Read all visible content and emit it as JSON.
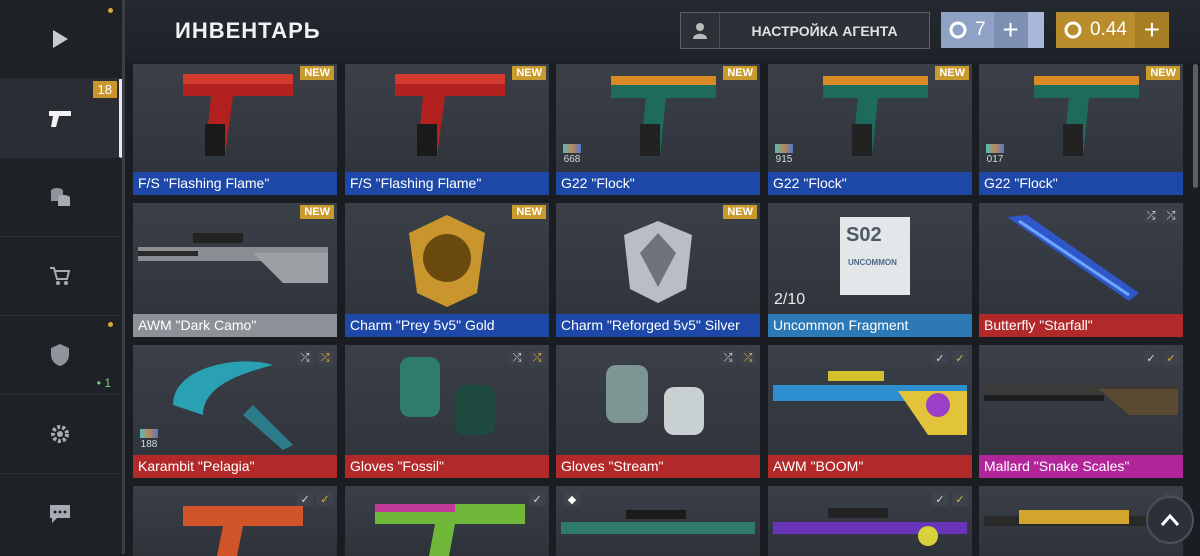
{
  "sidebar": {
    "inventory_badge": "18",
    "social_count": "• 1",
    "items": [
      {
        "icon": "play-icon"
      },
      {
        "icon": "pistol-icon"
      },
      {
        "icon": "coins-icon"
      },
      {
        "icon": "cart-icon"
      },
      {
        "icon": "clan-icon"
      },
      {
        "icon": "gear-icon"
      },
      {
        "icon": "chat-icon"
      }
    ]
  },
  "header": {
    "title": "ИНВЕНТАРЬ",
    "agent_button": "НАСТРОЙКА АГЕНТА",
    "silver_value": "7",
    "gold_value": "0.44",
    "plus": "+"
  },
  "fragment_progress": "2/10",
  "colors": {
    "blue_rarity": "#1d48a8",
    "red_rarity": "#b2292a",
    "pink_rarity": "#b0259a",
    "gray_rarity": "#8c9298",
    "light_blue_rarity": "#2d79b5",
    "gold_badge": "#c99a2c"
  },
  "items": [
    {
      "name": "F/S \"Flashing Flame\"",
      "new": "NEW",
      "sticker": ""
    },
    {
      "name": "F/S \"Flashing Flame\"",
      "new": "NEW",
      "sticker": ""
    },
    {
      "name": "G22 \"Flock\"",
      "new": "NEW",
      "sticker": "668"
    },
    {
      "name": "G22 \"Flock\"",
      "new": "NEW",
      "sticker": "915"
    },
    {
      "name": "G22 \"Flock\"",
      "new": "NEW",
      "sticker": "017"
    },
    {
      "name": "AWM \"Dark Camo\"",
      "new": "NEW",
      "sticker": ""
    },
    {
      "name": "Charm \"Prey 5v5\" Gold",
      "new": "NEW",
      "sticker": ""
    },
    {
      "name": "Charm \"Reforged 5v5\" Silver",
      "new": "NEW",
      "sticker": ""
    },
    {
      "name": "Uncommon Fragment",
      "new": "",
      "sticker": ""
    },
    {
      "name": "Butterfly \"Starfall\"",
      "new": "",
      "sticker": ""
    },
    {
      "name": "Karambit \"Pelagia\"",
      "new": "",
      "sticker": "188"
    },
    {
      "name": "Gloves \"Fossil\"",
      "new": "",
      "sticker": ""
    },
    {
      "name": "Gloves \"Stream\"",
      "new": "",
      "sticker": ""
    },
    {
      "name": "AWM \"BOOM\"",
      "new": "",
      "sticker": ""
    },
    {
      "name": "Mallard \"Snake Scales\"",
      "new": "",
      "sticker": ""
    }
  ],
  "fragment_card": {
    "code": "S02",
    "label": "UNCOMMON"
  }
}
